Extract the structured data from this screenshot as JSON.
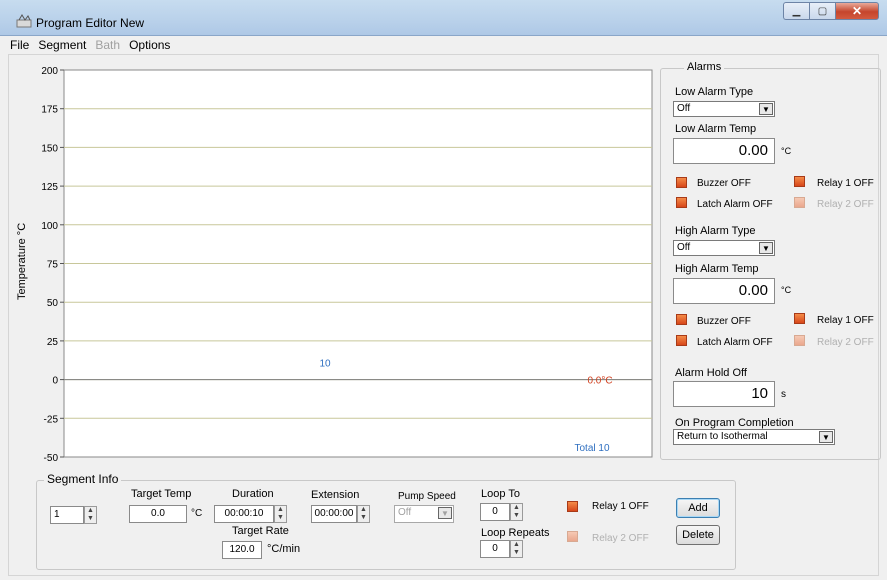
{
  "window": {
    "title": "Program Editor  New"
  },
  "menu": [
    {
      "label": "File",
      "enabled": true
    },
    {
      "label": "Segment",
      "enabled": true
    },
    {
      "label": "Bath",
      "enabled": false
    },
    {
      "label": "Options",
      "enabled": true
    }
  ],
  "chart": {
    "ylabel": "Temperature °C",
    "ytick_labels": [
      "200",
      "175",
      "150",
      "125",
      "100",
      "75",
      "50",
      "25",
      "0",
      "-25",
      "-50"
    ],
    "segment_marker": "10",
    "end_temp_label": "0.0°C",
    "total_label": "Total 10"
  },
  "chart_data": {
    "type": "line",
    "title": "",
    "xlabel": "",
    "ylabel": "Temperature °C",
    "ylim": [
      -50,
      200
    ],
    "ytick_values": [
      200,
      175,
      150,
      125,
      100,
      75,
      50,
      25,
      0,
      -25,
      -50
    ],
    "grid": true,
    "series": [
      {
        "x": [
          0,
          10
        ],
        "y": [
          0,
          0
        ]
      }
    ],
    "annotations": [
      "10",
      "0.0°C",
      "Total 10"
    ]
  },
  "alarms": {
    "title": "Alarms",
    "low_type_label": "Low Alarm Type",
    "low_type_value": "Off",
    "low_temp_label": "Low Alarm Temp",
    "low_temp_value": "0.00",
    "low_temp_unit": "°C",
    "low_buzzer": "Buzzer  OFF",
    "low_relay1": "Relay 1 OFF",
    "low_latch": "Latch Alarm  OFF",
    "low_relay2": "Relay 2  OFF",
    "high_type_label": "High Alarm Type",
    "high_type_value": "Off",
    "high_temp_label": "High Alarm Temp",
    "high_temp_value": "0.00",
    "high_temp_unit": "°C",
    "high_buzzer": "Buzzer  OFF",
    "high_relay1": "Relay 1 OFF",
    "high_latch": "Latch Alarm  OFF",
    "high_relay2": "Relay 2  OFF",
    "hold_off_label": "Alarm Hold Off",
    "hold_off_value": "10",
    "hold_off_unit": "s",
    "completion_label": "On Program Completion",
    "completion_value": "Return to Isothermal"
  },
  "segment": {
    "title": "Segment Info",
    "index_value": "1",
    "target_temp_label": "Target Temp",
    "target_temp_value": "0.0",
    "target_temp_unit": "°C",
    "duration_label": "Duration",
    "duration_value": "00:00:10",
    "extension_label": "Extension",
    "extension_value": "00:00:00",
    "pump_label": "Pump Speed",
    "pump_value": "Off",
    "loop_to_label": "Loop To",
    "loop_to_value": "0",
    "relay1": "Relay 1 OFF",
    "relay2": "Relay 2  OFF",
    "target_rate_label": "Target Rate",
    "target_rate_value": "120.0",
    "target_rate_unit": "°C/min",
    "loop_repeats_label": "Loop Repeats",
    "loop_repeats_value": "0",
    "add_label": "Add",
    "delete_label": "Delete"
  },
  "colors": {
    "plot_bg": "#ffffff",
    "grid": "#c8c79a",
    "marker_blue": "#2f6fc0",
    "end_temp_red": "#d04020",
    "led_on": "#e8602a"
  }
}
